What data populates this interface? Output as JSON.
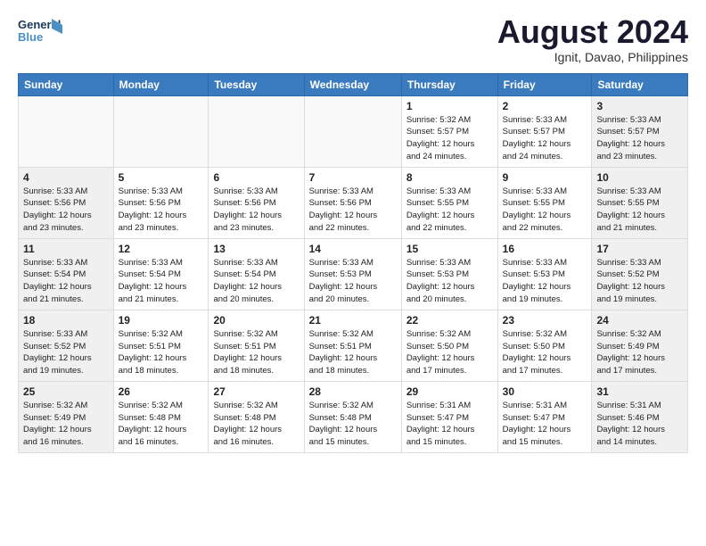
{
  "header": {
    "logo_line1": "General",
    "logo_line2": "Blue",
    "month_year": "August 2024",
    "location": "Ignit, Davao, Philippines"
  },
  "days_of_week": [
    "Sunday",
    "Monday",
    "Tuesday",
    "Wednesday",
    "Thursday",
    "Friday",
    "Saturday"
  ],
  "weeks": [
    [
      {
        "day": "",
        "info": ""
      },
      {
        "day": "",
        "info": ""
      },
      {
        "day": "",
        "info": ""
      },
      {
        "day": "",
        "info": ""
      },
      {
        "day": "1",
        "info": "Sunrise: 5:32 AM\nSunset: 5:57 PM\nDaylight: 12 hours\nand 24 minutes."
      },
      {
        "day": "2",
        "info": "Sunrise: 5:33 AM\nSunset: 5:57 PM\nDaylight: 12 hours\nand 24 minutes."
      },
      {
        "day": "3",
        "info": "Sunrise: 5:33 AM\nSunset: 5:57 PM\nDaylight: 12 hours\nand 23 minutes."
      }
    ],
    [
      {
        "day": "4",
        "info": "Sunrise: 5:33 AM\nSunset: 5:56 PM\nDaylight: 12 hours\nand 23 minutes."
      },
      {
        "day": "5",
        "info": "Sunrise: 5:33 AM\nSunset: 5:56 PM\nDaylight: 12 hours\nand 23 minutes."
      },
      {
        "day": "6",
        "info": "Sunrise: 5:33 AM\nSunset: 5:56 PM\nDaylight: 12 hours\nand 23 minutes."
      },
      {
        "day": "7",
        "info": "Sunrise: 5:33 AM\nSunset: 5:56 PM\nDaylight: 12 hours\nand 22 minutes."
      },
      {
        "day": "8",
        "info": "Sunrise: 5:33 AM\nSunset: 5:55 PM\nDaylight: 12 hours\nand 22 minutes."
      },
      {
        "day": "9",
        "info": "Sunrise: 5:33 AM\nSunset: 5:55 PM\nDaylight: 12 hours\nand 22 minutes."
      },
      {
        "day": "10",
        "info": "Sunrise: 5:33 AM\nSunset: 5:55 PM\nDaylight: 12 hours\nand 21 minutes."
      }
    ],
    [
      {
        "day": "11",
        "info": "Sunrise: 5:33 AM\nSunset: 5:54 PM\nDaylight: 12 hours\nand 21 minutes."
      },
      {
        "day": "12",
        "info": "Sunrise: 5:33 AM\nSunset: 5:54 PM\nDaylight: 12 hours\nand 21 minutes."
      },
      {
        "day": "13",
        "info": "Sunrise: 5:33 AM\nSunset: 5:54 PM\nDaylight: 12 hours\nand 20 minutes."
      },
      {
        "day": "14",
        "info": "Sunrise: 5:33 AM\nSunset: 5:53 PM\nDaylight: 12 hours\nand 20 minutes."
      },
      {
        "day": "15",
        "info": "Sunrise: 5:33 AM\nSunset: 5:53 PM\nDaylight: 12 hours\nand 20 minutes."
      },
      {
        "day": "16",
        "info": "Sunrise: 5:33 AM\nSunset: 5:53 PM\nDaylight: 12 hours\nand 19 minutes."
      },
      {
        "day": "17",
        "info": "Sunrise: 5:33 AM\nSunset: 5:52 PM\nDaylight: 12 hours\nand 19 minutes."
      }
    ],
    [
      {
        "day": "18",
        "info": "Sunrise: 5:33 AM\nSunset: 5:52 PM\nDaylight: 12 hours\nand 19 minutes."
      },
      {
        "day": "19",
        "info": "Sunrise: 5:32 AM\nSunset: 5:51 PM\nDaylight: 12 hours\nand 18 minutes."
      },
      {
        "day": "20",
        "info": "Sunrise: 5:32 AM\nSunset: 5:51 PM\nDaylight: 12 hours\nand 18 minutes."
      },
      {
        "day": "21",
        "info": "Sunrise: 5:32 AM\nSunset: 5:51 PM\nDaylight: 12 hours\nand 18 minutes."
      },
      {
        "day": "22",
        "info": "Sunrise: 5:32 AM\nSunset: 5:50 PM\nDaylight: 12 hours\nand 17 minutes."
      },
      {
        "day": "23",
        "info": "Sunrise: 5:32 AM\nSunset: 5:50 PM\nDaylight: 12 hours\nand 17 minutes."
      },
      {
        "day": "24",
        "info": "Sunrise: 5:32 AM\nSunset: 5:49 PM\nDaylight: 12 hours\nand 17 minutes."
      }
    ],
    [
      {
        "day": "25",
        "info": "Sunrise: 5:32 AM\nSunset: 5:49 PM\nDaylight: 12 hours\nand 16 minutes."
      },
      {
        "day": "26",
        "info": "Sunrise: 5:32 AM\nSunset: 5:48 PM\nDaylight: 12 hours\nand 16 minutes."
      },
      {
        "day": "27",
        "info": "Sunrise: 5:32 AM\nSunset: 5:48 PM\nDaylight: 12 hours\nand 16 minutes."
      },
      {
        "day": "28",
        "info": "Sunrise: 5:32 AM\nSunset: 5:48 PM\nDaylight: 12 hours\nand 15 minutes."
      },
      {
        "day": "29",
        "info": "Sunrise: 5:31 AM\nSunset: 5:47 PM\nDaylight: 12 hours\nand 15 minutes."
      },
      {
        "day": "30",
        "info": "Sunrise: 5:31 AM\nSunset: 5:47 PM\nDaylight: 12 hours\nand 15 minutes."
      },
      {
        "day": "31",
        "info": "Sunrise: 5:31 AM\nSunset: 5:46 PM\nDaylight: 12 hours\nand 14 minutes."
      }
    ]
  ]
}
